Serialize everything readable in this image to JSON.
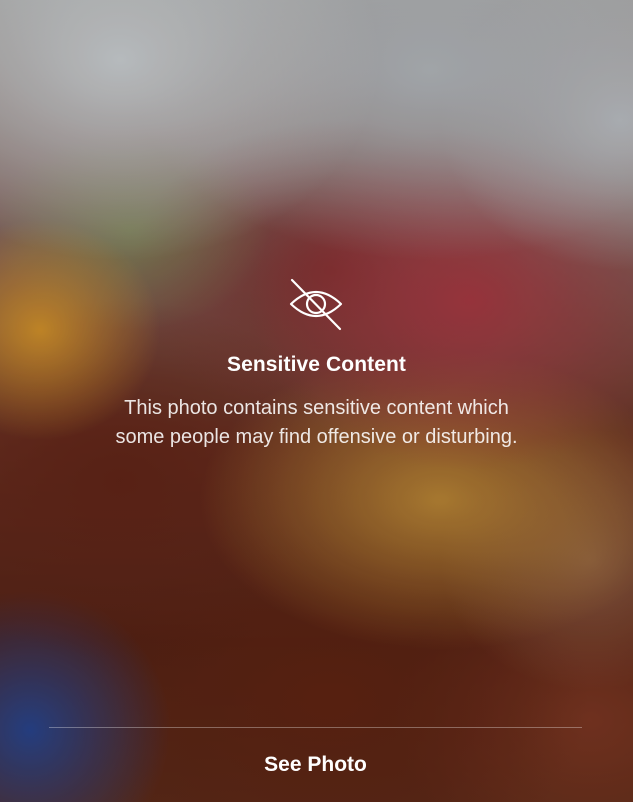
{
  "overlay": {
    "icon": "eye-slash-icon",
    "title": "Sensitive Content",
    "message_lines": [
      "This photo contains sensitive content which",
      "some people may find offensive or disturbing."
    ],
    "action_label": "See Photo"
  },
  "colors": {
    "text": "#ffffff",
    "divider": "rgba(255,255,255,0.32)"
  }
}
